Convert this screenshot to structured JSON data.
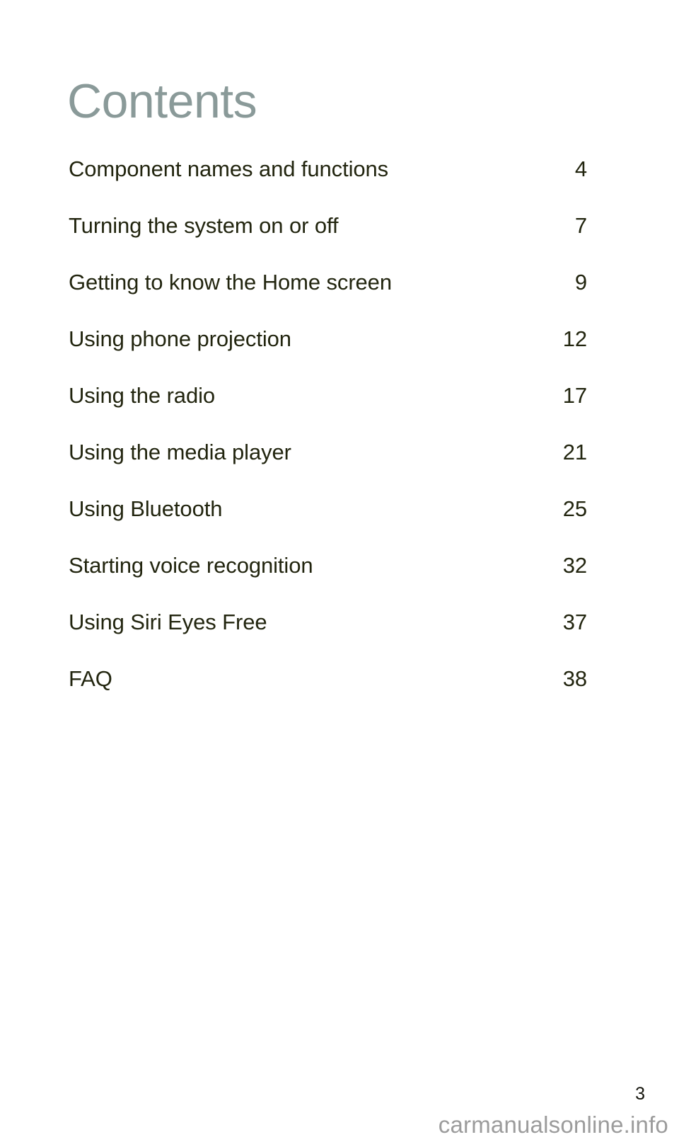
{
  "document": {
    "title": "Contents",
    "title_color": "#8a9a99",
    "text_color": "#22250f",
    "background_color": "#ffffff"
  },
  "toc": {
    "entries": [
      {
        "label": "Component names and functions",
        "page": "4"
      },
      {
        "label": "Turning the system on or off",
        "page": "7"
      },
      {
        "label": "Getting to know the Home screen",
        "page": "9"
      },
      {
        "label": "Using phone projection",
        "page": "12"
      },
      {
        "label": "Using the radio",
        "page": "17"
      },
      {
        "label": "Using the media player",
        "page": "21"
      },
      {
        "label": "Using Bluetooth",
        "page": "25"
      },
      {
        "label": "Starting voice recognition",
        "page": "32"
      },
      {
        "label": "Using Siri Eyes Free",
        "page": "37"
      },
      {
        "label": "FAQ",
        "page": "38"
      }
    ]
  },
  "footer": {
    "folio": "3",
    "watermark": "carmanualsonline.info",
    "watermark_color": "#9c9c9c"
  }
}
